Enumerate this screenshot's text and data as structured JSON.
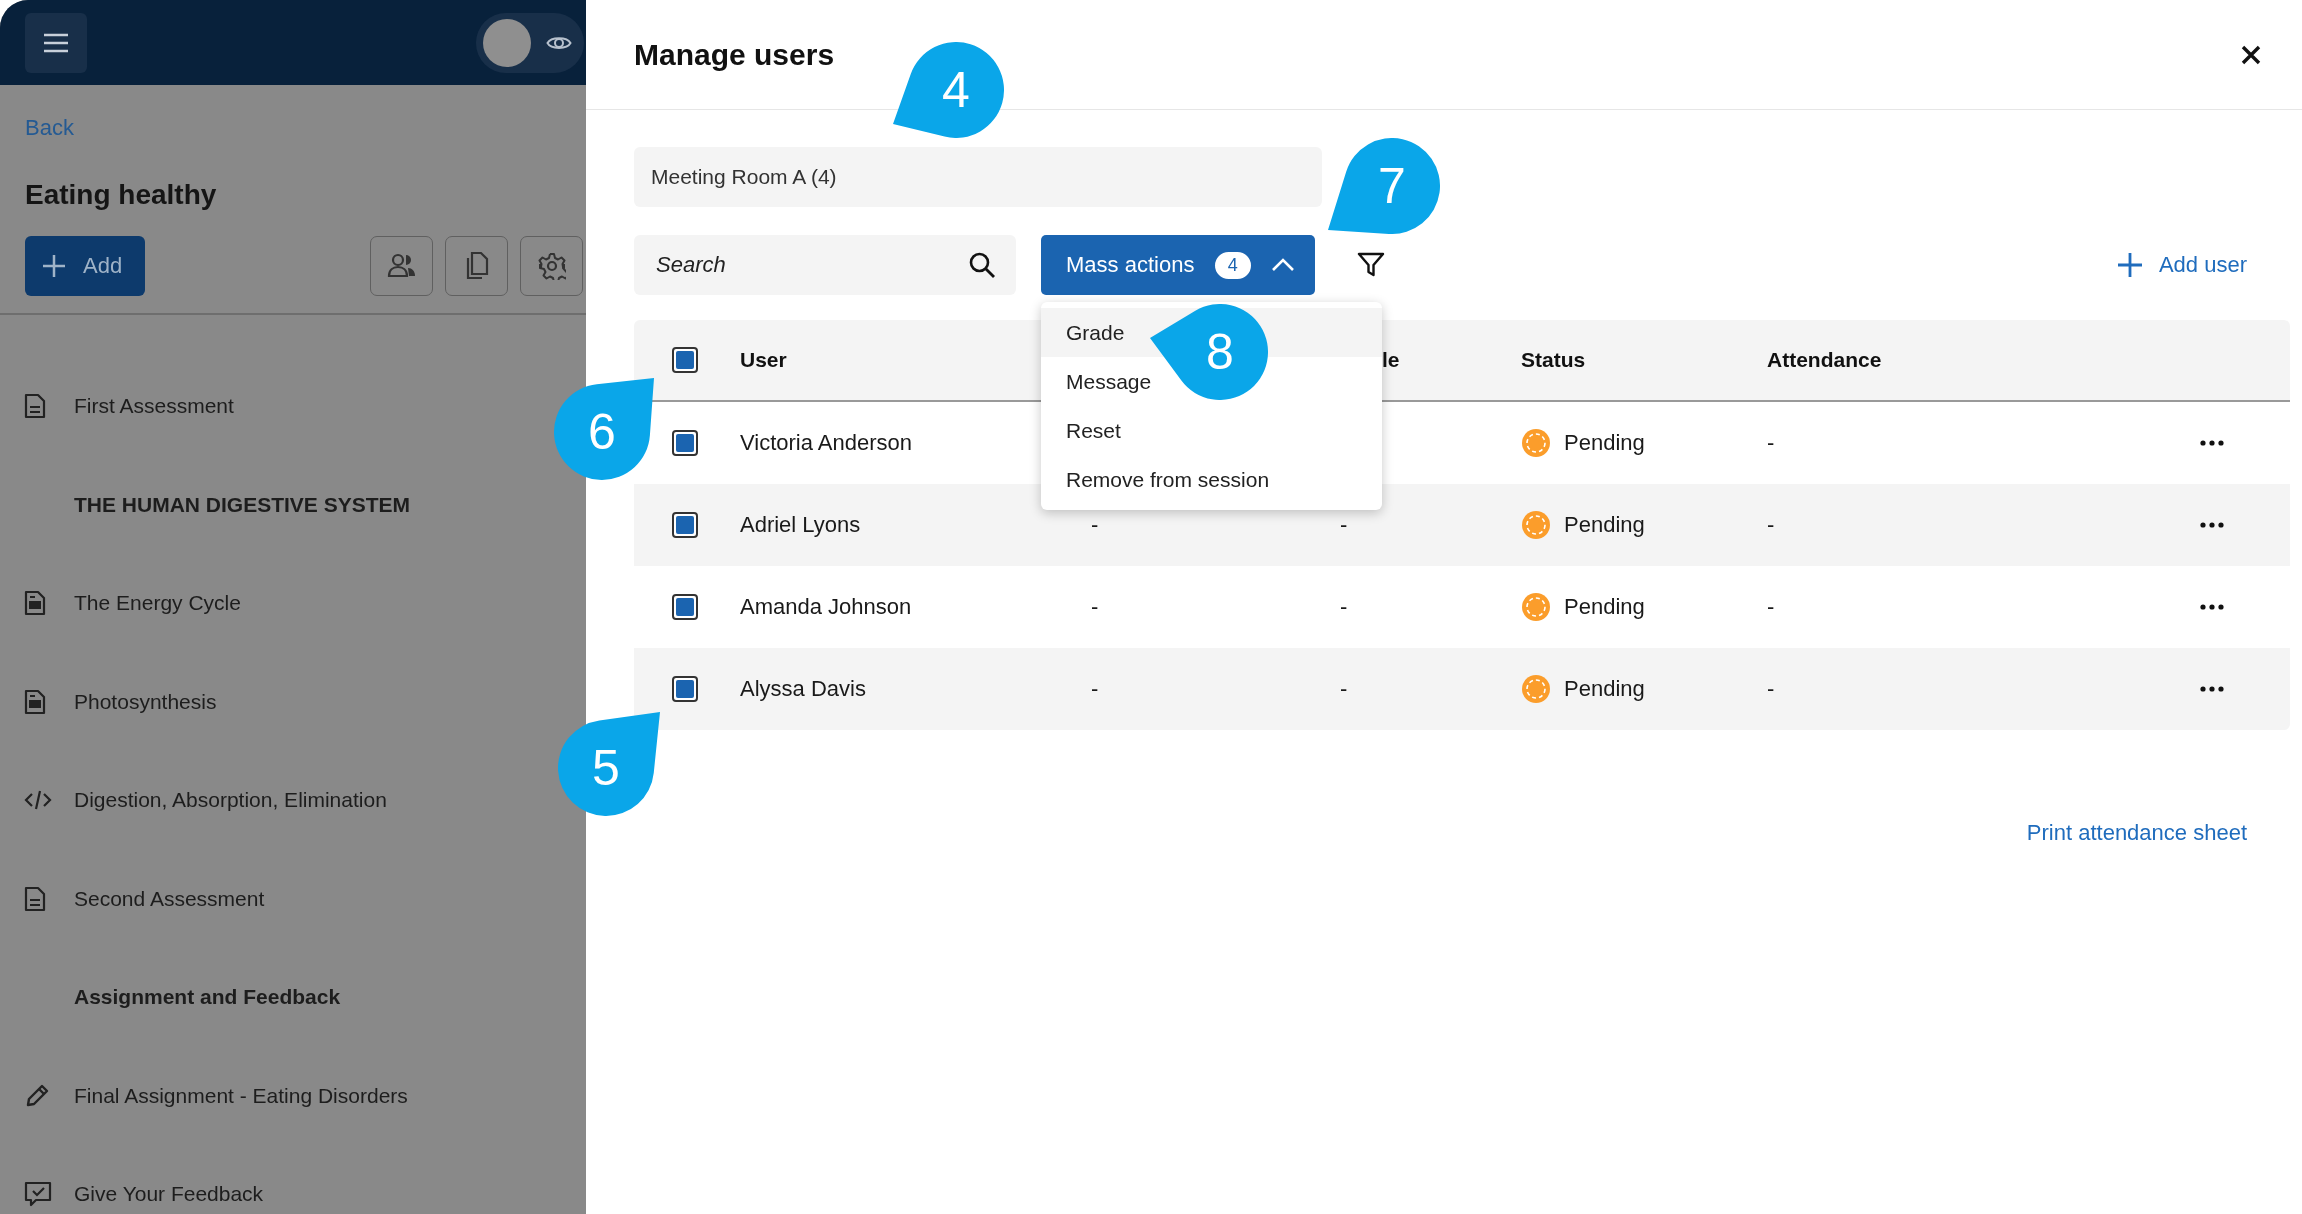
{
  "sidebar": {
    "view_toggle": {
      "on": false
    },
    "back": "Back",
    "title": "Eating healthy",
    "add_button": "Add",
    "items": [
      {
        "kind": "document",
        "label": "First Assessment"
      },
      {
        "kind": "section",
        "label": "THE HUMAN DIGESTIVE SYSTEM"
      },
      {
        "kind": "media",
        "label": "The Energy Cycle"
      },
      {
        "kind": "media",
        "label": "Photosynthesis"
      },
      {
        "kind": "code",
        "label": "Digestion, Absorption, Elimination"
      },
      {
        "kind": "document",
        "label": "Second Assessment"
      },
      {
        "kind": "section",
        "label": "Assignment and Feedback"
      },
      {
        "kind": "pencil",
        "label": "Final Assignment - Eating Disorders"
      },
      {
        "kind": "feedback",
        "label": "Give Your Feedback"
      }
    ]
  },
  "dialog": {
    "title": "Manage users",
    "group_field": {
      "value": "Meeting Room A (4)"
    },
    "search": {
      "placeholder": "Search"
    },
    "mass_actions": {
      "label": "Mass actions",
      "count": "4",
      "expanded": true,
      "menu": [
        {
          "label": "Grade",
          "selected": true
        },
        {
          "label": "Message",
          "selected": false
        },
        {
          "label": "Reset",
          "selected": false
        },
        {
          "label": "Remove from session",
          "selected": false
        }
      ]
    },
    "add_user": "Add user",
    "table": {
      "select_all_checked": true,
      "columns": {
        "user": "User",
        "column_3": "le",
        "status": "Status",
        "attendance": "Attendance"
      },
      "rows": [
        {
          "checked": true,
          "user": "Victoria Anderson",
          "status": "Pending",
          "attendance": "-"
        },
        {
          "checked": true,
          "user": "Adriel Lyons",
          "column_2": "-",
          "column_3": "-",
          "status": "Pending",
          "attendance": "-"
        },
        {
          "checked": true,
          "user": "Amanda Johnson",
          "column_2": "-",
          "column_3": "-",
          "status": "Pending",
          "attendance": "-"
        },
        {
          "checked": true,
          "user": "Alyssa Davis",
          "column_2": "-",
          "column_3": "-",
          "status": "Pending",
          "attendance": "-"
        }
      ]
    },
    "print_link": "Print attendance sheet"
  },
  "callouts": [
    {
      "number": "4"
    },
    {
      "number": "7"
    },
    {
      "number": "8"
    },
    {
      "number": "6"
    },
    {
      "number": "5"
    }
  ]
}
